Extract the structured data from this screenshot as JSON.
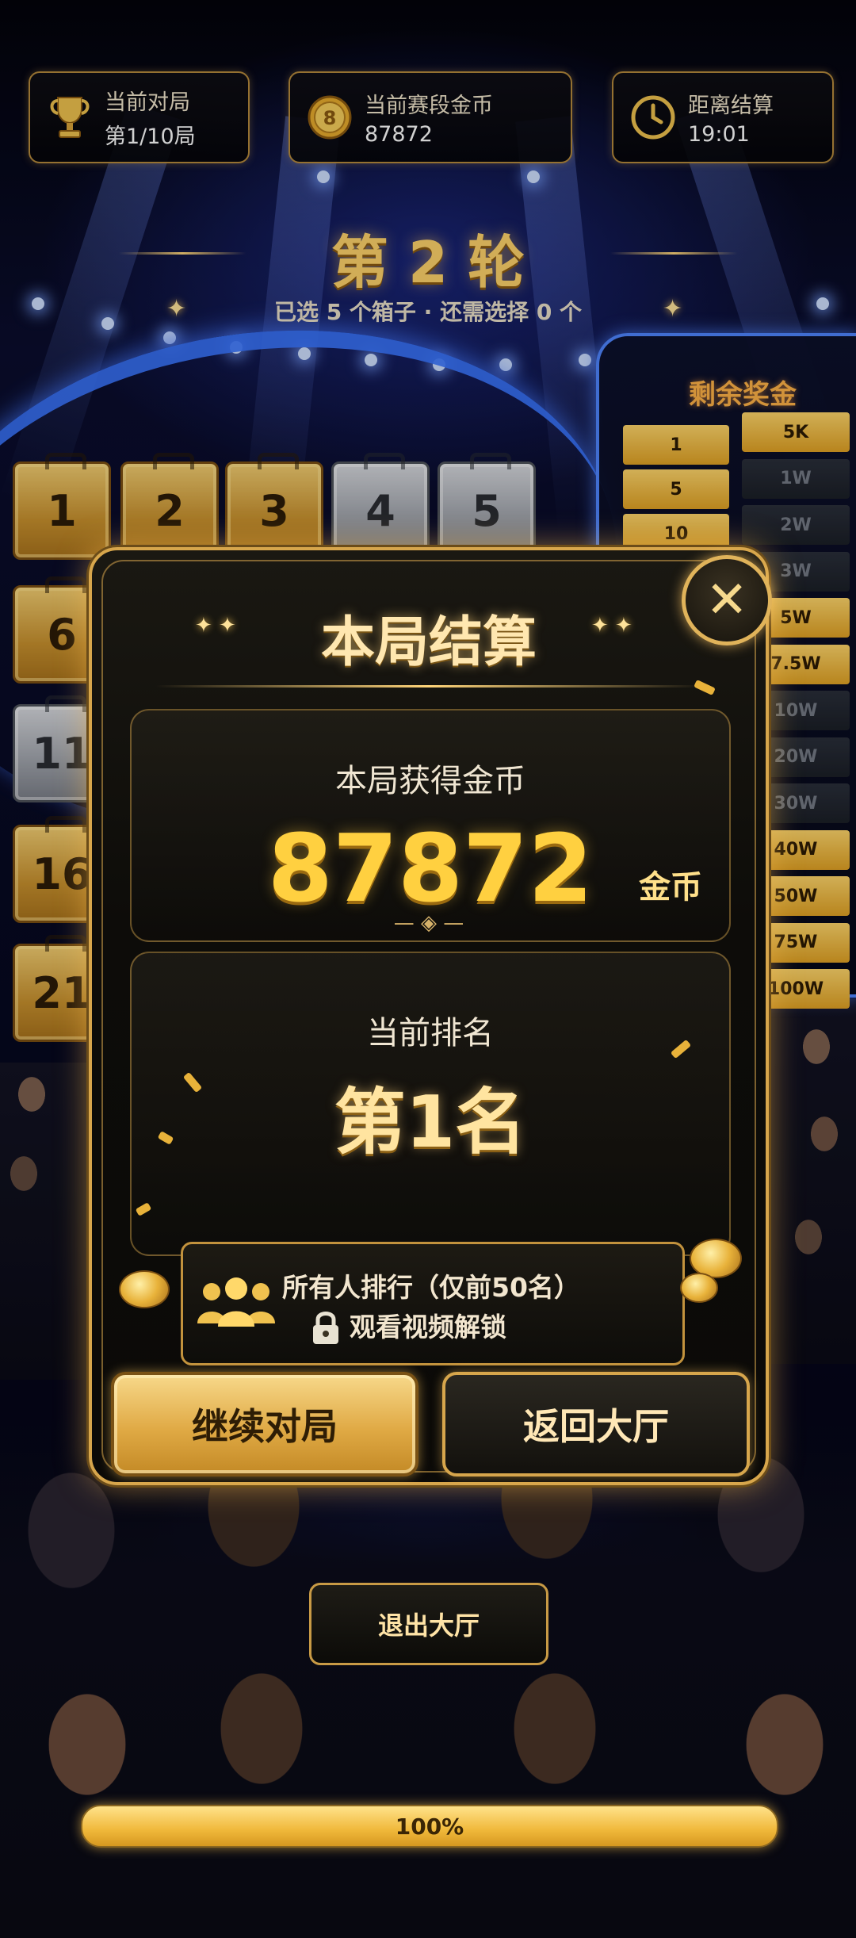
{
  "header": {
    "cards": [
      {
        "label": "当前对局",
        "value": "第1/10局",
        "icon": "trophy-icon"
      },
      {
        "label": "当前赛段金币",
        "value": "87872",
        "icon": "coin-icon"
      },
      {
        "label": "距离结算",
        "value": "19:01",
        "icon": "clock-icon"
      }
    ]
  },
  "round": {
    "title": "第 2 轮",
    "subtitle": "已选 5 个箱子 · 还需选择 0 个"
  },
  "cases": {
    "numbers": [
      "1",
      "2",
      "3",
      "4",
      "5",
      "6",
      "11",
      "16",
      "21"
    ]
  },
  "prize_board": {
    "title": "剩余奖金",
    "left_column": [
      "1",
      "5",
      "10"
    ],
    "right_column": [
      "5K",
      "1W",
      "2W",
      "3W",
      "5W",
      "7.5W",
      "10W",
      "20W",
      "30W",
      "40W",
      "50W",
      "75W",
      "100W"
    ]
  },
  "modal": {
    "title": "本局结算",
    "coins_label": "本局获得金币",
    "coins_value": "87872",
    "coins_unit": "金币",
    "rank_label": "当前排名",
    "rank_value": "第1名",
    "all_rank_title": "所有人排行（仅前50名）",
    "all_rank_unlock": "观看视频解锁",
    "continue_label": "继续对局",
    "lobby_label": "返回大厅",
    "close_label": "✕"
  },
  "footer": {
    "exit_label": "退出大厅",
    "progress_label": "100%",
    "progress_value": 1.0
  },
  "colors": {
    "gold": "#ffd040",
    "accent_blue": "#4f86ff",
    "frame_gold": "#d7a64c"
  }
}
